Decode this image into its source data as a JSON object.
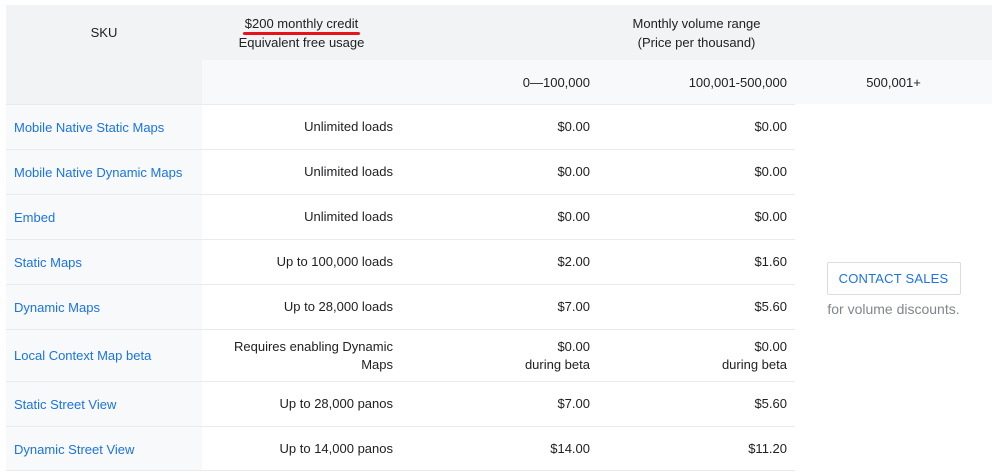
{
  "header": {
    "sku": "SKU",
    "credit_title": "$200 monthly credit",
    "credit_sub": "Equivalent free usage",
    "volume_title": "Monthly volume range",
    "volume_sub": "(Price per thousand)"
  },
  "ranges": [
    "0—100,000",
    "100,001-500,000",
    "500,001+"
  ],
  "rows": [
    {
      "name": "Mobile Native Static Maps",
      "free": "Unlimited loads",
      "p1": "$0.00",
      "p2": "$0.00"
    },
    {
      "name": "Mobile Native Dynamic Maps",
      "free": "Unlimited loads",
      "p1": "$0.00",
      "p2": "$0.00"
    },
    {
      "name": "Embed",
      "free": "Unlimited loads",
      "p1": "$0.00",
      "p2": "$0.00"
    },
    {
      "name": "Static Maps",
      "free": "Up to 100,000 loads",
      "p1": "$2.00",
      "p2": "$1.60"
    },
    {
      "name": "Dynamic Maps",
      "free": "Up to 28,000 loads",
      "p1": "$7.00",
      "p2": "$5.60"
    },
    {
      "name": "Local Context Map beta",
      "free_line1": "Requires enabling Dynamic",
      "free_line2": "Maps",
      "p1_line1": "$0.00",
      "p1_line2": "during beta",
      "p2_line1": "$0.00",
      "p2_line2": "during beta"
    },
    {
      "name": "Static Street View",
      "free": "Up to 28,000 panos",
      "p1": "$7.00",
      "p2": "$5.60"
    },
    {
      "name": "Dynamic Street View",
      "free": "Up to 14,000 panos",
      "p1": "$14.00",
      "p2": "$11.20"
    }
  ],
  "contact": {
    "button": "CONTACT SALES",
    "note": "for volume discounts."
  },
  "colors": {
    "link": "#1a73e8",
    "header_bg": "#f1f3f4",
    "underline": "#e8131a"
  }
}
